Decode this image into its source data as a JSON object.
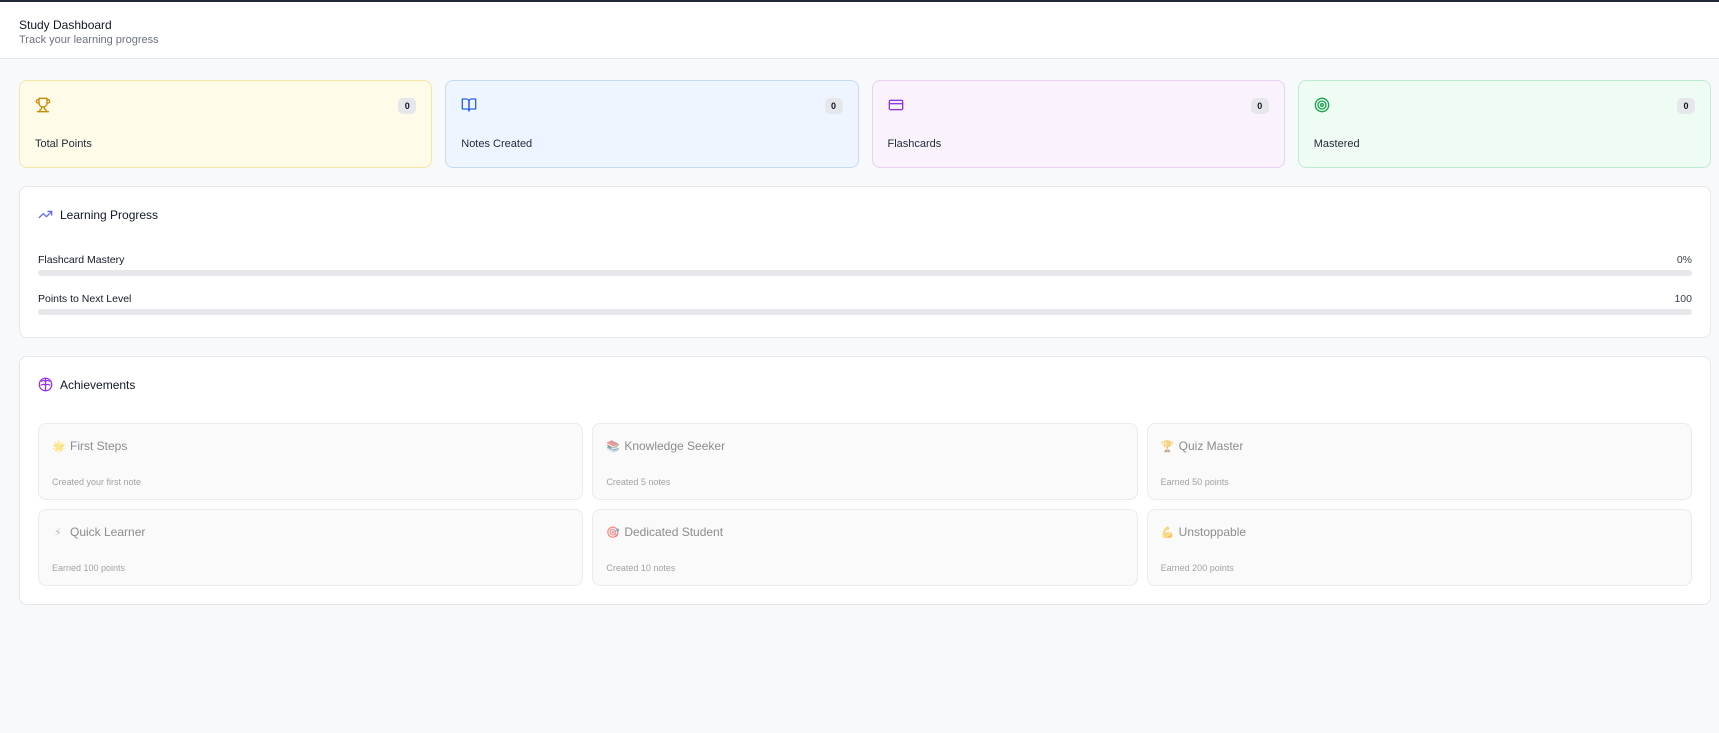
{
  "header": {
    "title": "Study Dashboard",
    "subtitle": "Track your learning progress"
  },
  "stats": [
    {
      "label": "Total Points",
      "value": "0",
      "icon": "trophy-icon",
      "color": "#ca8a04"
    },
    {
      "label": "Notes Created",
      "value": "0",
      "icon": "book-open-icon",
      "color": "#2563eb"
    },
    {
      "label": "Flashcards",
      "value": "0",
      "icon": "credit-card-icon",
      "color": "#9333ea"
    },
    {
      "label": "Mastered",
      "value": "0",
      "icon": "target-icon",
      "color": "#16a34a"
    }
  ],
  "progress": {
    "title": "Learning Progress",
    "icon": "trending-up-icon",
    "rows": [
      {
        "label": "Flashcard Mastery",
        "value": "0%",
        "fraction": 0
      },
      {
        "label": "Points to Next Level",
        "value": "100",
        "fraction": 0
      }
    ]
  },
  "achievements": {
    "title": "Achievements",
    "icon": "brain-icon",
    "items": [
      {
        "emoji": "🌟",
        "title": "First Steps",
        "desc": "Created your first note"
      },
      {
        "emoji": "📚",
        "title": "Knowledge Seeker",
        "desc": "Created 5 notes"
      },
      {
        "emoji": "🏆",
        "title": "Quiz Master",
        "desc": "Earned 50 points"
      },
      {
        "emoji": "⚡",
        "title": "Quick Learner",
        "desc": "Earned 100 points"
      },
      {
        "emoji": "🎯",
        "title": "Dedicated Student",
        "desc": "Created 10 notes"
      },
      {
        "emoji": "💪",
        "title": "Unstoppable",
        "desc": "Earned 200 points"
      }
    ]
  },
  "colors": {
    "accent": "#6366f1",
    "brain": "#9333ea"
  }
}
